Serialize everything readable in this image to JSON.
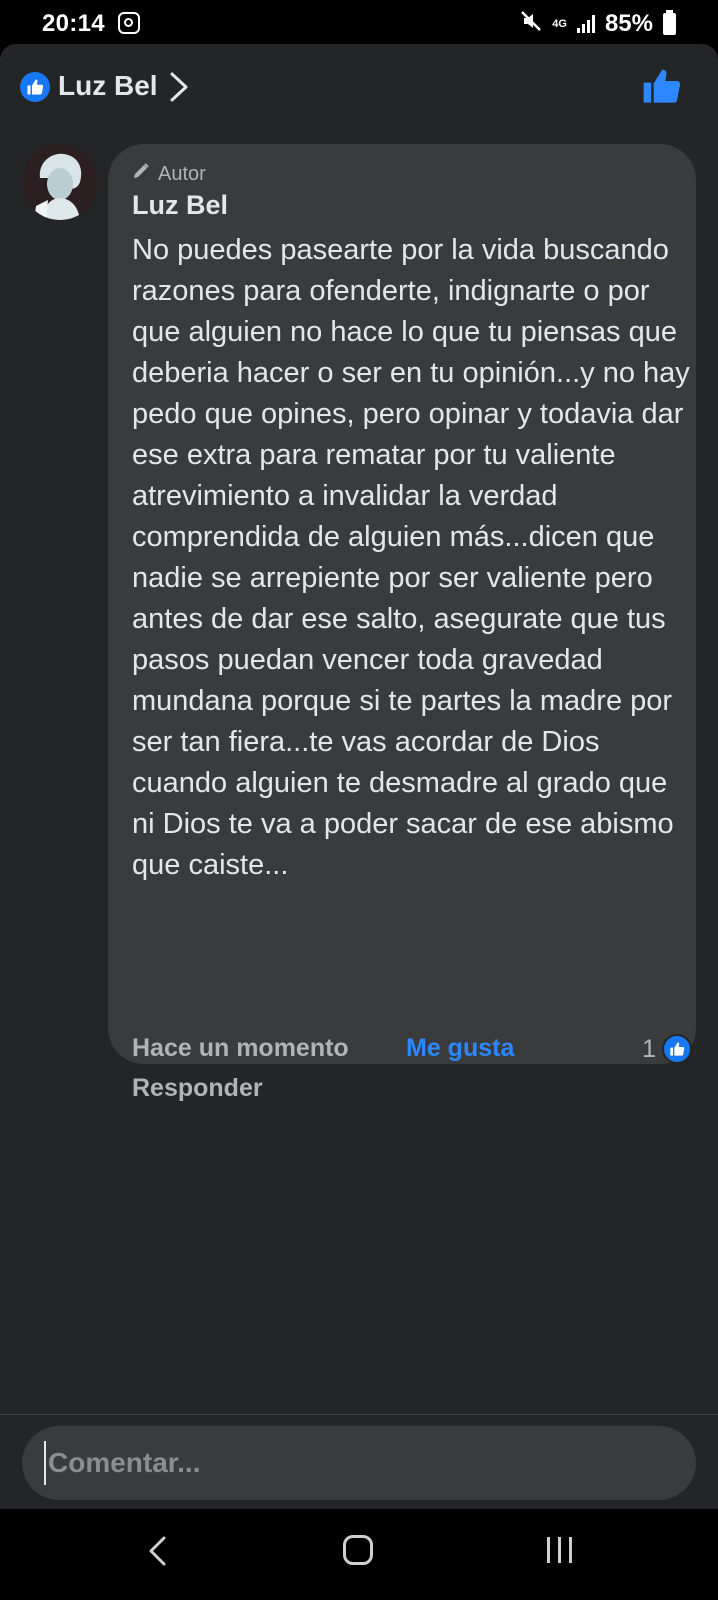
{
  "status_bar": {
    "time": "20:14",
    "network": "4G",
    "battery": "85%"
  },
  "header": {
    "title": "Luz Bel",
    "accent_color": "#1877f2"
  },
  "comment": {
    "author_badge": "Autor",
    "author_name": "Luz Bel",
    "text": "No puedes pasearte por la vida buscando razones para ofenderte, indignarte o por que alguien no hace lo que tu piensas que deberia hacer o ser en tu opinión...y no hay pedo que opines, pero opinar y todavia dar ese extra para rematar por tu valiente atrevimiento a invalidar la verdad comprendida de alguien más...dicen que nadie se arrepiente por ser valiente pero antes de dar ese salto, asegurate que tus pasos puedan vencer toda gravedad mundana porque si te partes la madre por ser tan fiera...te vas acordar de Dios cuando alguien te desmadre al grado que ni Dios te va a poder sacar de ese abismo que caiste...",
    "time": "Hace un momento",
    "like_label": "Me gusta",
    "reply_label": "Responder",
    "reaction_count": "1"
  },
  "composer": {
    "placeholder": "Comentar..."
  },
  "icons": {
    "header_badge": "thumbs-up-icon",
    "header_chevron": "chevron-right-icon",
    "header_action": "thumbs-up-icon",
    "author_badge": "pencil-icon",
    "reaction": "thumbs-up-icon",
    "nav_back": "back-icon",
    "nav_home": "home-icon",
    "nav_recents": "recents-icon"
  }
}
